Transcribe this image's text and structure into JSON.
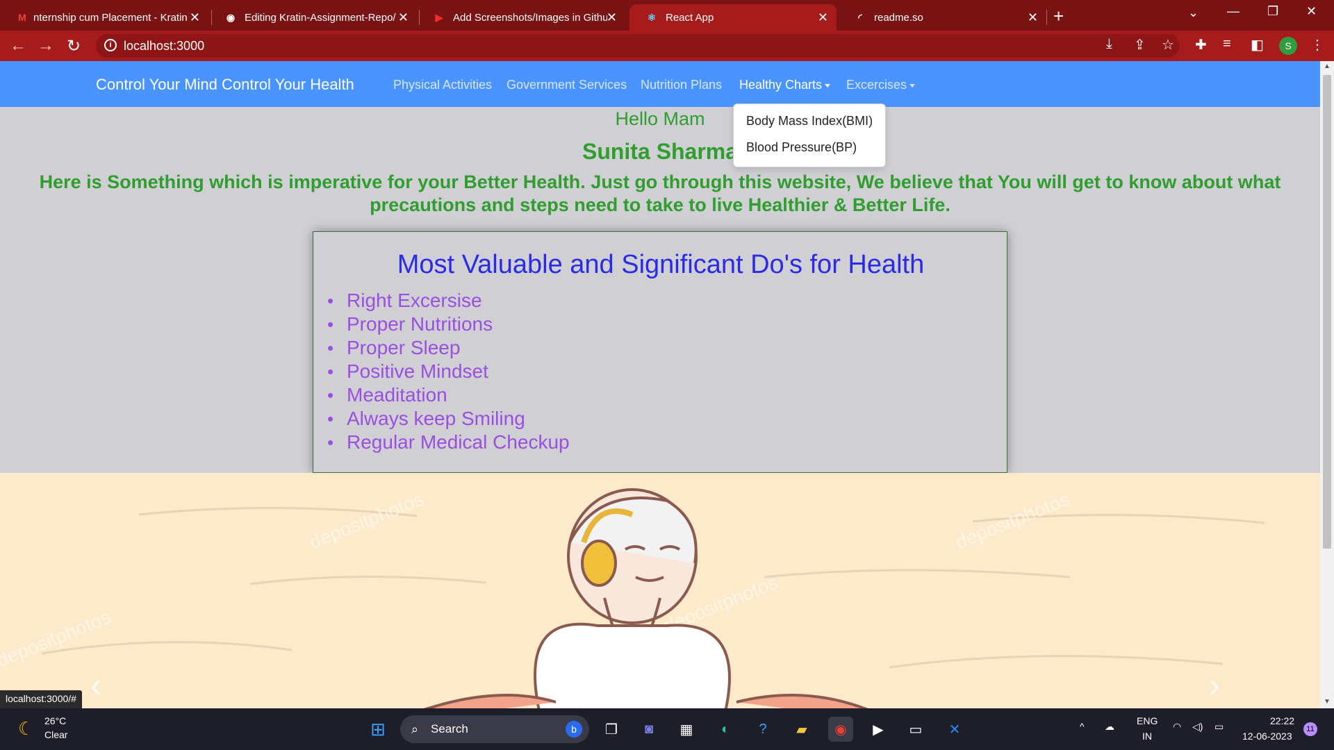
{
  "browser": {
    "tabs": [
      {
        "title": "nternship cum Placement - Kratin",
        "icon": "gmail-icon",
        "icon_glyph": "M"
      },
      {
        "title": "Editing Kratin-Assignment-Repo/",
        "icon": "github-icon",
        "icon_glyph": "◉"
      },
      {
        "title": "Add Screenshots/Images in Githu",
        "icon": "youtube-icon",
        "icon_glyph": "▶"
      },
      {
        "title": "React App",
        "icon": "react-icon",
        "icon_glyph": "⚛"
      },
      {
        "title": "readme.so",
        "icon": "loading-icon",
        "icon_glyph": "◜"
      }
    ],
    "address": "localhost:3000",
    "profile_initial": "S",
    "status_url": "localhost:3000/#",
    "accent": "#a61b1b"
  },
  "navbar": {
    "brand": "Control Your Mind Control Your Health",
    "links": [
      "Physical Activities",
      "Government Services",
      "Nutrition Plans",
      "Healthy Charts",
      "Excercises"
    ],
    "dropdown": [
      "Body Mass Index(BMI)",
      "Blood Pressure(BP)"
    ],
    "color": "#4a94ff"
  },
  "greeting": {
    "hello": "Hello Mam",
    "name": "Sunita Sharma",
    "intro": "Here is Something which is imperative for your Better Health. Just go through this website, We believe that You will get to know about what precautions and steps need to take to live Healthier & Better Life."
  },
  "dos": {
    "title": "Most Valuable and Significant Do's for Health",
    "items": [
      "Right Excersise",
      "Proper Nutritions",
      "Proper Sleep",
      "Positive Mindset",
      "Meaditation",
      "Always keep Smiling",
      "Regular Medical Checkup"
    ]
  },
  "hero": {
    "watermark": "depositphotos"
  },
  "taskbar": {
    "temperature": "26°C",
    "condition": "Clear",
    "search_label": "Search",
    "language": "ENG",
    "region": "IN",
    "time": "22:22",
    "date": "12-06-2023",
    "notifications": "11"
  }
}
